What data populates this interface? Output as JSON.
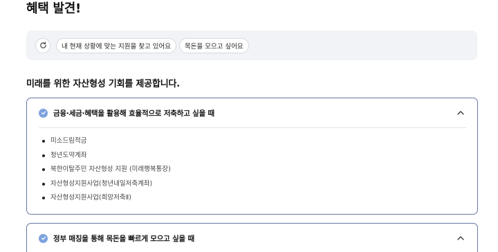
{
  "page": {
    "title": "혜택 발견!"
  },
  "filters": {
    "chips": [
      "내 현재 상황에 맞는 지원을 찾고 있어요",
      "목돈을 모으고 싶어요"
    ]
  },
  "section": {
    "title": "미래를 위한 자산형성 기회를 제공합니다."
  },
  "cards": [
    {
      "title": "금융·세금·혜택을 활용해 효율적으로 저축하고 싶을 때",
      "expanded": true,
      "items": [
        "미소드림적금",
        "청년도약계좌",
        "북한이탈주민 자산형성 지원 (미래행복통장)",
        "자산형성지원사업(청년내일저축계좌)",
        "자산형성지원사업(희망저축Ⅱ)"
      ]
    },
    {
      "title": "정부 매칭을 통해 목돈을 빠르게 모으고 싶을 때",
      "expanded": true,
      "items": []
    }
  ],
  "colors": {
    "accent": "#7ea2df",
    "card_border": "#6476a3",
    "filter_bg": "#f1f3f6"
  }
}
